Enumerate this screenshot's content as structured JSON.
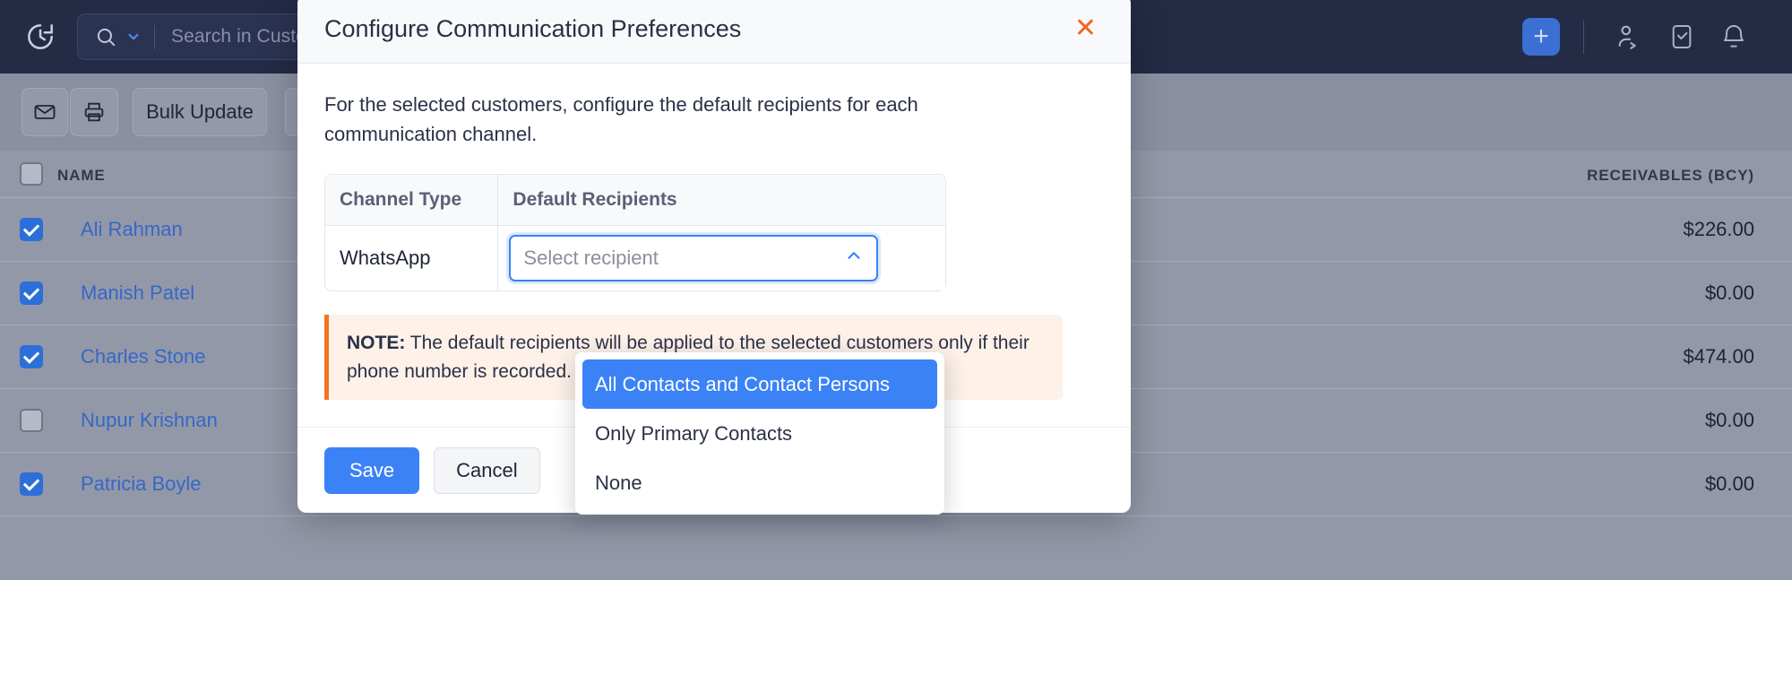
{
  "app": {
    "topbar": {
      "recent_icon": "clock-history-icon",
      "search_icon": "search-icon",
      "search_scope_caret": "chevron-down-icon",
      "search_placeholder": "Search in Customers ( / )",
      "add_button_label": "+",
      "icons": [
        "referral-icon",
        "tasks-clipboard-icon",
        "notifications-bell-icon"
      ]
    },
    "toolbar": {
      "email_icon": "envelope-icon",
      "print_icon": "printer-icon",
      "bulk_update_label": "Bulk Update"
    },
    "list": {
      "columns": [
        "NAME",
        "RECEIVABLES (BCY)"
      ],
      "rows": [
        {
          "checked": true,
          "name": "Ali Rahman",
          "receivables": "$226.00"
        },
        {
          "checked": true,
          "name": "Manish Patel",
          "receivables": "$0.00"
        },
        {
          "checked": true,
          "name": "Charles Stone",
          "receivables": "$474.00"
        },
        {
          "checked": false,
          "name": "Nupur Krishnan",
          "receivables": "$0.00"
        },
        {
          "checked": true,
          "name": "Patricia Boyle",
          "receivables": "$0.00"
        }
      ]
    }
  },
  "modal": {
    "title": "Configure Communication Preferences",
    "close_icon": "close-icon",
    "intro": "For the selected customers, configure the default recipients for each communication channel.",
    "table": {
      "headers": [
        "Channel Type",
        "Default Recipients"
      ],
      "rows": [
        {
          "channel": "WhatsApp",
          "recipient_placeholder": "Select recipient"
        }
      ]
    },
    "select": {
      "placeholder": "Select recipient",
      "caret_icon": "chevron-up-icon",
      "open": true,
      "options": [
        "All Contacts and Contact Persons",
        "Only Primary Contacts",
        "None"
      ],
      "highlighted_option": "All Contacts and Contact Persons"
    },
    "note": {
      "label": "NOTE:",
      "text": " The default recipients will be applied to the selected customers only if their phone number is recorded."
    },
    "footer": {
      "save_label": "Save",
      "cancel_label": "Cancel"
    }
  },
  "colors": {
    "accent_blue": "#3b82f6",
    "close_orange": "#f26522",
    "note_border": "#f2751f",
    "note_bg": "#fdf1e8",
    "topbar_bg": "#232b45"
  }
}
